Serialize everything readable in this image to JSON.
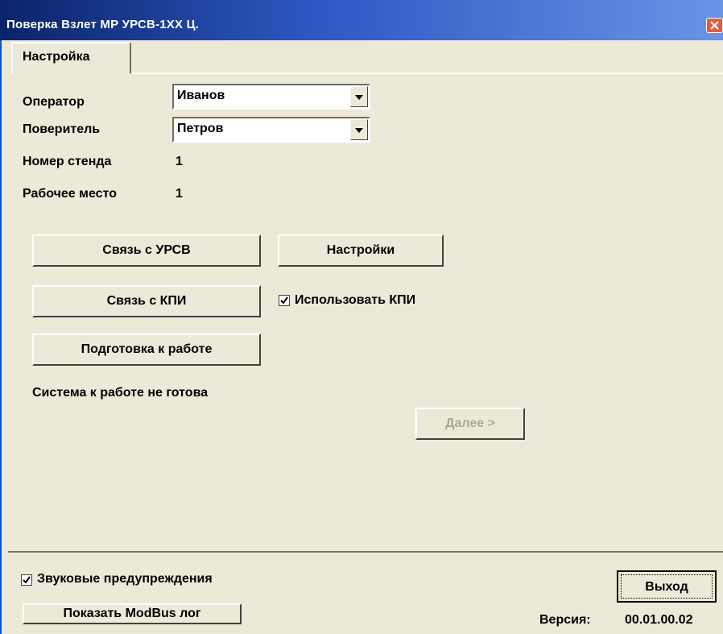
{
  "window": {
    "title": "Поверка Взлет МР УРСВ-1ХХ Ц."
  },
  "tabs": [
    {
      "label": "Настройка"
    }
  ],
  "form": {
    "operator_label": "Оператор",
    "operator_value": "Иванов",
    "verifier_label": "Поверитель",
    "verifier_value": "Петров",
    "stand_label": "Номер стенда",
    "stand_value": "1",
    "workplace_label": "Рабочее место",
    "workplace_value": "1"
  },
  "buttons": {
    "connect_ursv": "Связь с УРСВ",
    "settings": "Настройки",
    "connect_kpi": "Связь с КПИ",
    "prepare": "Подготовка к работе",
    "next": "Далее >",
    "exit": "Выход",
    "show_modbus_log": "Показать ModBus лог"
  },
  "checkboxes": {
    "use_kpi": {
      "label": "Использовать КПИ",
      "checked": true
    },
    "sound_alerts": {
      "label": "Звуковые предупреждения",
      "checked": true
    }
  },
  "status": {
    "text": "Система к работе не готова"
  },
  "version": {
    "label": "Версия:",
    "value": "00.01.00.02"
  },
  "icons": {
    "close": "close-icon",
    "dropdown": "chevron-down-icon",
    "check": "check-icon"
  },
  "colors": {
    "titlebar": "#0a246a",
    "face": "#ece9d8",
    "close": "#e55b3a"
  }
}
